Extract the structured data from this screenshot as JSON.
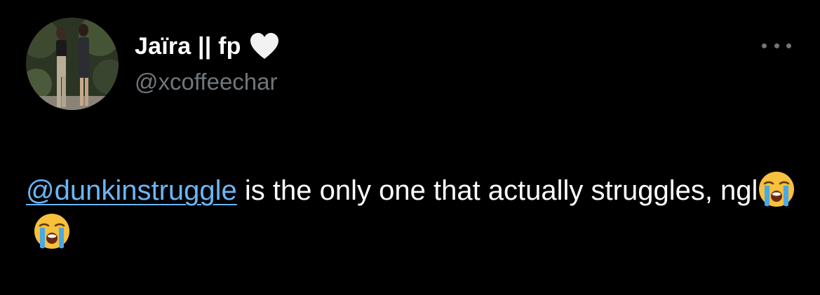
{
  "tweet": {
    "author": {
      "display_name": "Jaïra || fp",
      "name_icon": "white-heart-icon",
      "handle": "@xcoffeechar",
      "avatar": "avatar-photo"
    },
    "more_icon": "more-options-icon",
    "body": {
      "mention": "@dunkinstruggle",
      "text": " is the only one that actually struggles, ngl",
      "emojis": [
        "loudly-crying-face-icon",
        "loudly-crying-face-icon"
      ]
    }
  },
  "colors": {
    "background": "#000000",
    "primary_text": "#ffffff",
    "secondary_text": "#71767b",
    "link": "#6cb5f5"
  }
}
